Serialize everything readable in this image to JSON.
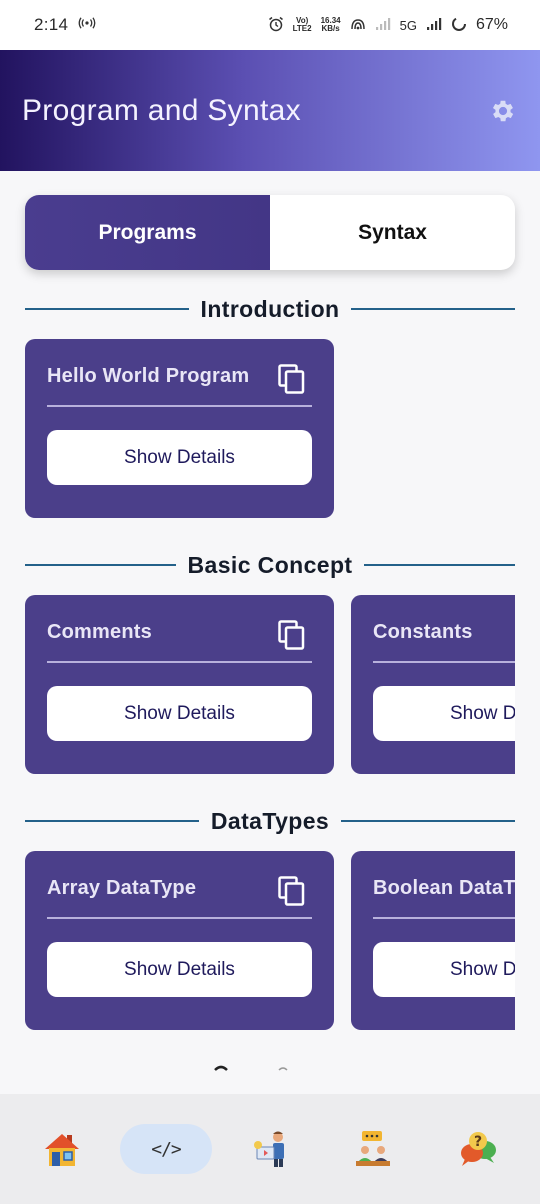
{
  "status_bar": {
    "time": "2:14",
    "network_speed_value": "16.34",
    "network_speed_unit": "KB/s",
    "volte_label": "Vo)",
    "lte_label": "LTE2",
    "network_type": "5G",
    "battery": "67%"
  },
  "app_bar": {
    "title": "Program and Syntax",
    "settings_icon": "gear-icon"
  },
  "toggle": {
    "programs_label": "Programs",
    "syntax_label": "Syntax",
    "active": "Programs"
  },
  "sections": [
    {
      "title": "Introduction",
      "cards": [
        {
          "title": "Hello World Program",
          "button": "Show Details"
        }
      ]
    },
    {
      "title": "Basic Concept",
      "cards": [
        {
          "title": "Comments",
          "button": "Show Details"
        },
        {
          "title": "Constants",
          "button": "Show D"
        }
      ]
    },
    {
      "title": "DataTypes",
      "cards": [
        {
          "title": "Array DataType",
          "button": "Show Details"
        },
        {
          "title": "Boolean DataT",
          "button": "Show D"
        }
      ]
    }
  ],
  "bottom_nav": {
    "items": [
      "home-icon",
      "code-icon",
      "teacher-icon",
      "discussion-icon",
      "help-chat-icon"
    ],
    "active": "code-icon",
    "code_glyph": "</>"
  },
  "colors": {
    "card": "#4b3f8a",
    "accent_line": "#24618a",
    "toggle_active": "#4a3d8f",
    "nav_active": "#d6e4f7"
  }
}
